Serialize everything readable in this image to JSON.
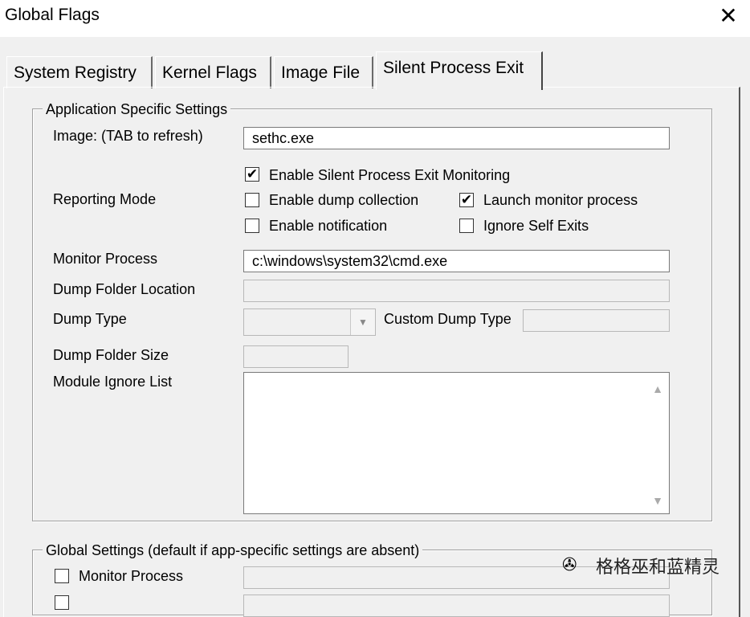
{
  "window": {
    "title": "Global Flags",
    "close_glyph": "✕"
  },
  "tabs": [
    {
      "label": "System Registry"
    },
    {
      "label": "Kernel Flags"
    },
    {
      "label": "Image File"
    },
    {
      "label": "Silent Process Exit",
      "active": true
    }
  ],
  "app_settings": {
    "legend": "Application Specific Settings",
    "image_label": "Image:  (TAB to refresh)",
    "image_value": "sethc.exe",
    "reporting_label": "Reporting Mode",
    "checkboxes": {
      "enable_monitoring": {
        "label": "Enable Silent Process Exit Monitoring",
        "checked": true,
        "mark": "✔"
      },
      "enable_dump": {
        "label": "Enable dump collection",
        "checked": false,
        "mark": ""
      },
      "launch_monitor": {
        "label": "Launch monitor process",
        "checked": true,
        "mark": "✔"
      },
      "enable_notification": {
        "label": "Enable notification",
        "checked": false,
        "mark": ""
      },
      "ignore_self_exits": {
        "label": "Ignore Self Exits",
        "checked": false,
        "mark": ""
      }
    },
    "monitor_process_label": "Monitor Process",
    "monitor_process_value": "c:\\windows\\system32\\cmd.exe",
    "dump_folder_location_label": "Dump Folder Location",
    "dump_folder_location_value": "",
    "dump_type_label": "Dump Type",
    "dump_type_value": "",
    "custom_dump_type_label": "Custom Dump Type",
    "custom_dump_type_value": "",
    "dump_folder_size_label": "Dump Folder Size",
    "dump_folder_size_value": "",
    "module_ignore_list_label": "Module Ignore List"
  },
  "global_settings": {
    "legend": "Global Settings (default if app-specific settings are absent)",
    "monitor_process_label": "Monitor Process",
    "monitor_process_checked": false
  },
  "icons": {
    "dropdown": "▼",
    "scroll_up": "▲",
    "scroll_down": "▼",
    "wechat": "✇"
  },
  "watermark": {
    "text": "格格巫和蓝精灵"
  },
  "colors": {
    "background": "#f0f0f0",
    "field": "#ffffff",
    "border": "#7a7a7a"
  }
}
